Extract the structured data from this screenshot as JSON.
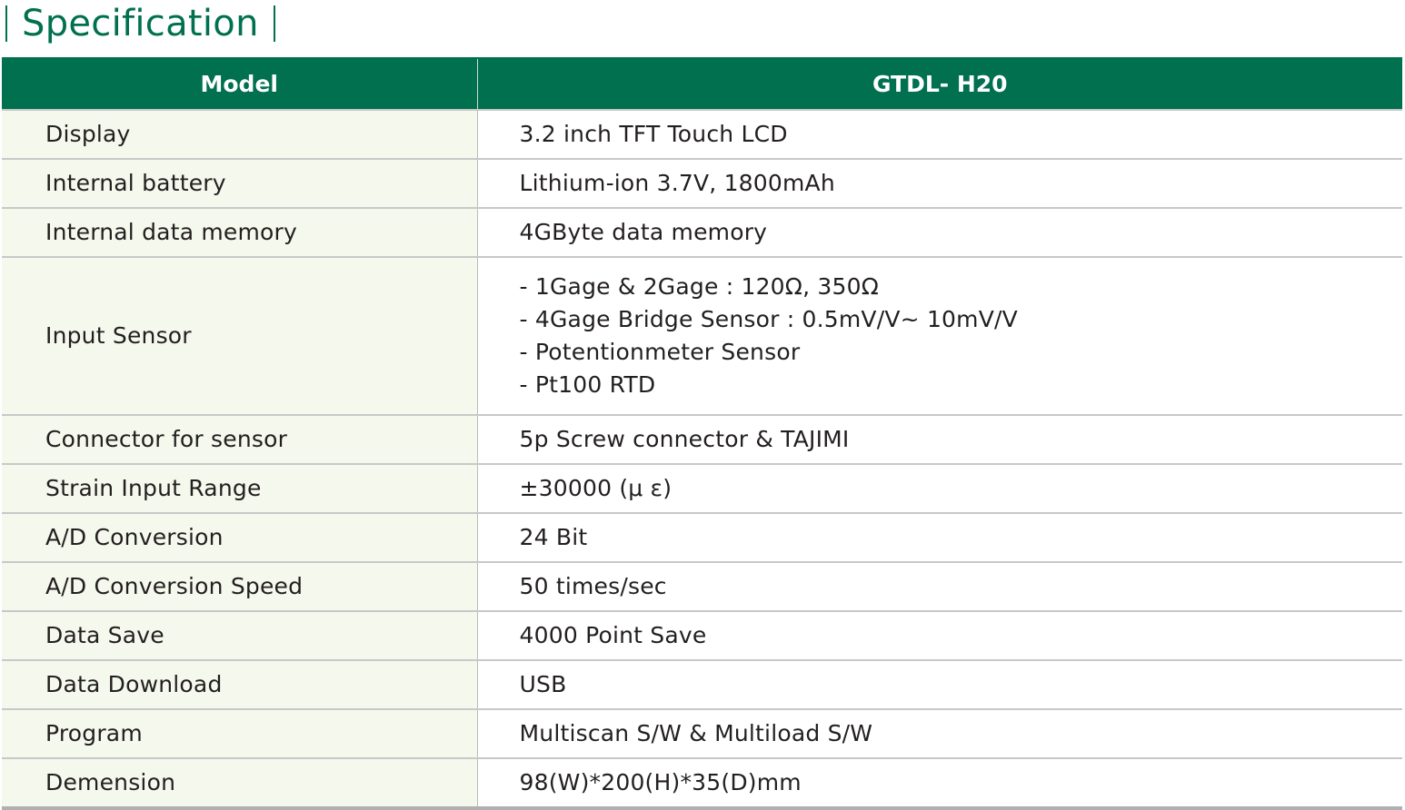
{
  "title": "Specification",
  "table": {
    "header": {
      "model_label": "Model",
      "model_value": "GTDL- H20"
    },
    "rows": [
      {
        "label": "Display",
        "value": "3.2 inch TFT Touch LCD"
      },
      {
        "label": "Internal battery",
        "value": "Lithium-ion 3.7V, 1800mAh"
      },
      {
        "label": "Internal data memory",
        "value": "4GByte data memory"
      },
      {
        "label": "Input Sensor",
        "lines": [
          "- 1Gage & 2Gage : 120Ω, 350Ω",
          "- 4Gage Bridge Sensor : 0.5mV/V~ 10mV/V",
          "- Potentionmeter Sensor",
          "- Pt100 RTD"
        ]
      },
      {
        "label": "Connector for sensor",
        "value": "5p Screw connector & TAJIMI"
      },
      {
        "label": "Strain Input Range",
        "value": "±30000 (μ ε)"
      },
      {
        "label": "A/D Conversion",
        "value": "24 Bit"
      },
      {
        "label": "A/D Conversion Speed",
        "value": "50 times/sec"
      },
      {
        "label": "Data Save",
        "value": "4000 Point Save"
      },
      {
        "label": "Data Download",
        "value": "USB"
      },
      {
        "label": "Program",
        "value": "Multiscan S/W & Multiload S/W"
      },
      {
        "label": "Demension",
        "value": "98(W)*200(H)*35(D)mm"
      }
    ]
  },
  "colors": {
    "brand_green": "#00704f",
    "label_bg": "#f5f8ed",
    "divider": "#c8c8c8"
  }
}
